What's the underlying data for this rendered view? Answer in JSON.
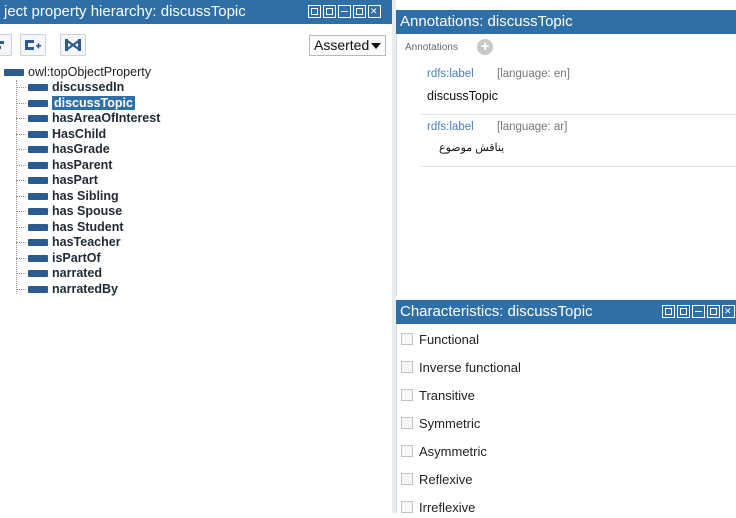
{
  "left_panel": {
    "title": "ject property hierarchy: discussTopic",
    "dropdown": {
      "selected": "Asserted"
    },
    "tree": {
      "root": "owl:topObjectProperty",
      "items": [
        {
          "label": "discussedIn",
          "selected": false
        },
        {
          "label": "discussTopic",
          "selected": true
        },
        {
          "label": "hasAreaOfInterest",
          "selected": false
        },
        {
          "label": "HasChild",
          "selected": false
        },
        {
          "label": "hasGrade",
          "selected": false
        },
        {
          "label": "hasParent",
          "selected": false
        },
        {
          "label": "hasPart",
          "selected": false
        },
        {
          "label": "has Sibling",
          "selected": false
        },
        {
          "label": "has Spouse",
          "selected": false
        },
        {
          "label": "has Student",
          "selected": false
        },
        {
          "label": "hasTeacher",
          "selected": false
        },
        {
          "label": "isPartOf",
          "selected": false
        },
        {
          "label": "narrated",
          "selected": false
        },
        {
          "label": "narratedBy",
          "selected": false
        }
      ]
    }
  },
  "annotations_panel": {
    "title": "Annotations: discussTopic",
    "section_label": "Annotations",
    "entries": [
      {
        "property": "rdfs:label",
        "language": "[language: en]",
        "value": "discussTopic"
      },
      {
        "property": "rdfs:label",
        "language": "[language: ar]",
        "value": "يناقش موضوع"
      }
    ]
  },
  "characteristics_panel": {
    "title": "Characteristics: discussTopic",
    "items": [
      {
        "label": "Functional",
        "checked": false
      },
      {
        "label": "Inverse functional",
        "checked": false
      },
      {
        "label": "Transitive",
        "checked": false
      },
      {
        "label": "Symmetric",
        "checked": false
      },
      {
        "label": "Asymmetric",
        "checked": false
      },
      {
        "label": "Reflexive",
        "checked": false
      },
      {
        "label": "Irreflexive",
        "checked": false
      }
    ]
  },
  "colors": {
    "title_bar": "#2f6fa8",
    "property_icon": "#2b5b91",
    "selection": "#2f6fa8",
    "annotation_property": "#4a7fb8"
  },
  "icons": {
    "toolbar": [
      "add-subproperty-icon",
      "add-sibling-property-icon",
      "delete-property-icon"
    ],
    "window_controls": [
      "view-icon",
      "split-icon",
      "minimize-icon",
      "maximize-icon",
      "close-icon"
    ]
  }
}
